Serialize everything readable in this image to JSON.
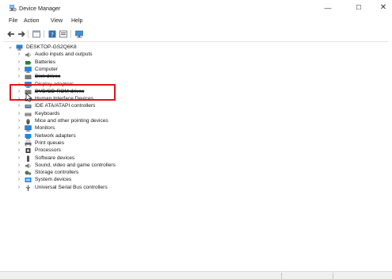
{
  "window": {
    "title": "Device Manager",
    "minimize": "—",
    "maximize": "☐",
    "close": "✕"
  },
  "menu": [
    "File",
    "Action",
    "View",
    "Help"
  ],
  "toolbar": [
    "back-icon",
    "forward-icon",
    "properties-icon",
    "help-icon",
    "show-hidden-icon",
    "monitor-icon"
  ],
  "tree": {
    "root": "DESKTOP-GS2Q6K8",
    "items": [
      {
        "label": "Audio inputs and outputs",
        "icon": "speaker-icon",
        "color": "#7a7a7a"
      },
      {
        "label": "Batteries",
        "icon": "battery-icon",
        "color": "#2e7d32"
      },
      {
        "label": "Computer",
        "icon": "computer-icon",
        "color": "#1e88e5"
      },
      {
        "label": "Disk drives",
        "icon": "disk-icon",
        "color": "#777777"
      },
      {
        "label": "Display adapters",
        "icon": "display-icon",
        "color": "#1e88e5"
      },
      {
        "label": "DVD/CD-ROM drives",
        "icon": "dvd-icon",
        "color": "#777777"
      },
      {
        "label": "Human Interface Devices",
        "icon": "hid-icon",
        "color": "#6d6d6d"
      },
      {
        "label": "IDE ATA/ATAPI controllers",
        "icon": "ide-icon",
        "color": "#4a6b8a"
      },
      {
        "label": "Keyboards",
        "icon": "keyboard-icon",
        "color": "#6d6d6d"
      },
      {
        "label": "Mice and other pointing devices",
        "icon": "mouse-icon",
        "color": "#555555"
      },
      {
        "label": "Monitors",
        "icon": "monitor-icon",
        "color": "#1e88e5"
      },
      {
        "label": "Network adapters",
        "icon": "network-icon",
        "color": "#1e88e5"
      },
      {
        "label": "Print queues",
        "icon": "printer-icon",
        "color": "#666666"
      },
      {
        "label": "Processors",
        "icon": "processor-icon",
        "color": "#333333"
      },
      {
        "label": "Software devices",
        "icon": "software-icon",
        "color": "#555555"
      },
      {
        "label": "Sound, video and game controllers",
        "icon": "sound-icon",
        "color": "#7a7a7a"
      },
      {
        "label": "Storage controllers",
        "icon": "storage-icon",
        "color": "#4a7a4a"
      },
      {
        "label": "System devices",
        "icon": "system-icon",
        "color": "#1e88e5"
      },
      {
        "label": "Universal Serial Bus controllers",
        "icon": "usb-icon",
        "color": "#555555"
      }
    ]
  },
  "colors": {
    "highlight": "#e0141c"
  }
}
